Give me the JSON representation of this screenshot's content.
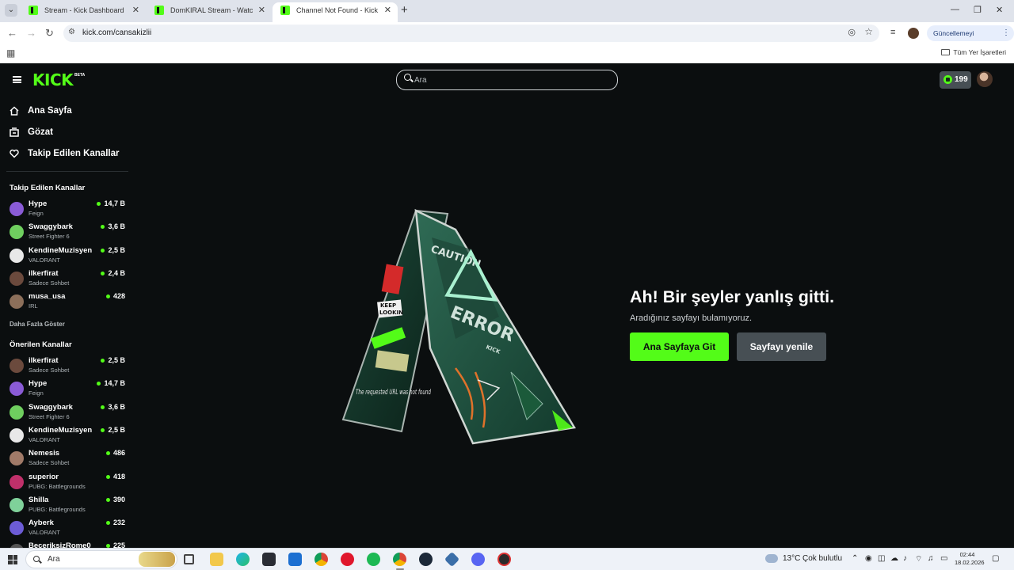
{
  "browser": {
    "tabs": [
      {
        "title": "Stream - Kick Dashboard",
        "active": false
      },
      {
        "title": "DomKIRAL Stream - Watch Live",
        "active": false
      },
      {
        "title": "Channel Not Found - Kick Strea",
        "active": true
      }
    ],
    "new_tab_label": "+",
    "url": "kick.com/cansakizlii",
    "update_button": "Güncellemeyi tamamla",
    "all_bookmarks": "Tüm Yer İşaretleri"
  },
  "kick": {
    "logo": "KICK",
    "beta": "BETA",
    "search_placeholder": "Ara",
    "kicks_count": "199",
    "nav": [
      {
        "label": "Ana Sayfa",
        "icon": "home-icon"
      },
      {
        "label": "Gözat",
        "icon": "browse-icon"
      },
      {
        "label": "Takip Edilen Kanallar",
        "icon": "heart-icon"
      }
    ],
    "followed_title": "Takip Edilen Kanallar",
    "followed": [
      {
        "name": "Hype",
        "category": "Feign",
        "viewers": "14,7 B",
        "color": "#8a5bd6"
      },
      {
        "name": "Swaggybark",
        "category": "Street Fighter 6",
        "viewers": "3,6 B",
        "color": "#6fcf5f"
      },
      {
        "name": "KendineMuzisyen",
        "category": "VALORANT",
        "viewers": "2,5 B",
        "color": "#e8e8e8"
      },
      {
        "name": "ilkerfirat",
        "category": "Sadece Sohbet",
        "viewers": "2,4 B",
        "color": "#6b4a3d"
      },
      {
        "name": "musa_usa",
        "category": "IRL",
        "viewers": "428",
        "color": "#8c6f5a"
      }
    ],
    "show_more": "Daha Fazla Göster",
    "recommended_title": "Önerilen Kanallar",
    "recommended": [
      {
        "name": "ilkerfirat",
        "category": "Sadece Sohbet",
        "viewers": "2,5 B",
        "color": "#6b4a3d"
      },
      {
        "name": "Hype",
        "category": "Feign",
        "viewers": "14,7 B",
        "color": "#8a5bd6"
      },
      {
        "name": "Swaggybark",
        "category": "Street Fighter 6",
        "viewers": "3,6 B",
        "color": "#6fcf5f"
      },
      {
        "name": "KendineMuzisyen",
        "category": "VALORANT",
        "viewers": "2,5 B",
        "color": "#e8e8e8"
      },
      {
        "name": "Nemesis",
        "category": "Sadece Sohbet",
        "viewers": "486",
        "color": "#a07a68"
      },
      {
        "name": "superior",
        "category": "PUBG: Battlegrounds",
        "viewers": "418",
        "color": "#c0306a"
      },
      {
        "name": "Shilla",
        "category": "PUBG: Battlegrounds",
        "viewers": "390",
        "color": "#7fd19a"
      },
      {
        "name": "Ayberk",
        "category": "VALORANT",
        "viewers": "232",
        "color": "#6c5cd6"
      },
      {
        "name": "BeceriksizRome0",
        "category": "",
        "viewers": "225",
        "color": "#555"
      }
    ],
    "error": {
      "sign_caution": "CAUTION",
      "sign_error": "ERROR",
      "sign_brand": "KICK",
      "sticker_keep": "KEEP",
      "sticker_looking": "LOOKIN",
      "sticker_url": "The requested URL was not found",
      "title": "Ah! Bir şeyler yanlış gitti.",
      "subtitle": "Aradığınız sayfayı bulamıyoruz.",
      "home_button": "Ana Sayfaya Git",
      "reload_button": "Sayfayı yenile"
    }
  },
  "taskbar": {
    "search_text": "Ara",
    "weather_temp": "13°C",
    "weather_desc": "Çok bulutlu",
    "time": "02:44",
    "date": "18.02.2026"
  },
  "colors": {
    "kick_green": "#53fc18",
    "bg": "#0b0e0f",
    "secondary_button": "#474f54"
  }
}
